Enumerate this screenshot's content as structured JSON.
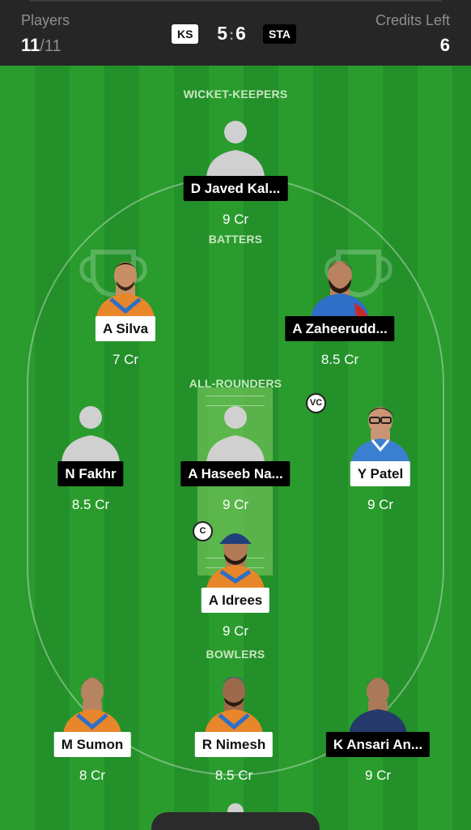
{
  "header": {
    "players_label": "Players",
    "players_selected": "11",
    "players_max": "/11",
    "credits_label": "Credits Left",
    "credits_value": "6",
    "team_a": "KS",
    "team_b": "STA",
    "score_a": "5",
    "score_sep": ":",
    "score_b": "6"
  },
  "sections": {
    "wicket_keepers": "WICKET-KEEPERS",
    "batters": "BATTERS",
    "all_rounders": "ALL-ROUNDERS",
    "bowlers": "BOWLERS"
  },
  "players": [
    {
      "name": "D Javed Kal...",
      "credits": "9 Cr",
      "pill": "black",
      "avatar": "placeholder-silhouette"
    },
    {
      "name": "A Silva",
      "credits": "7 Cr",
      "pill": "white",
      "avatar": "player-photo-orange-kit"
    },
    {
      "name": "A Zaheerudd...",
      "credits": "8.5 Cr",
      "pill": "black",
      "avatar": "player-photo-blue-kit"
    },
    {
      "name": "N Fakhr",
      "credits": "8.5 Cr",
      "pill": "black",
      "avatar": "placeholder-silhouette"
    },
    {
      "name": "A Haseeb Na...",
      "credits": "9 Cr",
      "pill": "black",
      "avatar": "placeholder-silhouette"
    },
    {
      "name": "Y Patel",
      "credits": "9 Cr",
      "pill": "white",
      "avatar": "player-photo-blue-kit",
      "role": "VC"
    },
    {
      "name": "A Idrees",
      "credits": "9 Cr",
      "pill": "white",
      "avatar": "player-photo-orange-kit",
      "role": "C"
    },
    {
      "name": "M Sumon",
      "credits": "8 Cr",
      "pill": "white",
      "avatar": "player-photo-orange-kit"
    },
    {
      "name": "R Nimesh",
      "credits": "8.5 Cr",
      "pill": "white",
      "avatar": "player-photo-orange-kit"
    },
    {
      "name": "K Ansari An...",
      "credits": "9 Cr",
      "pill": "black",
      "avatar": "player-photo-navy-kit"
    }
  ],
  "colors": {
    "header_bg": "#262626",
    "field_green": "#2a9c2e",
    "pitch": "#6cbf55",
    "kit_orange": "#e8862a",
    "kit_blue": "#2e6fc7",
    "kit_navy": "#253a6b"
  }
}
